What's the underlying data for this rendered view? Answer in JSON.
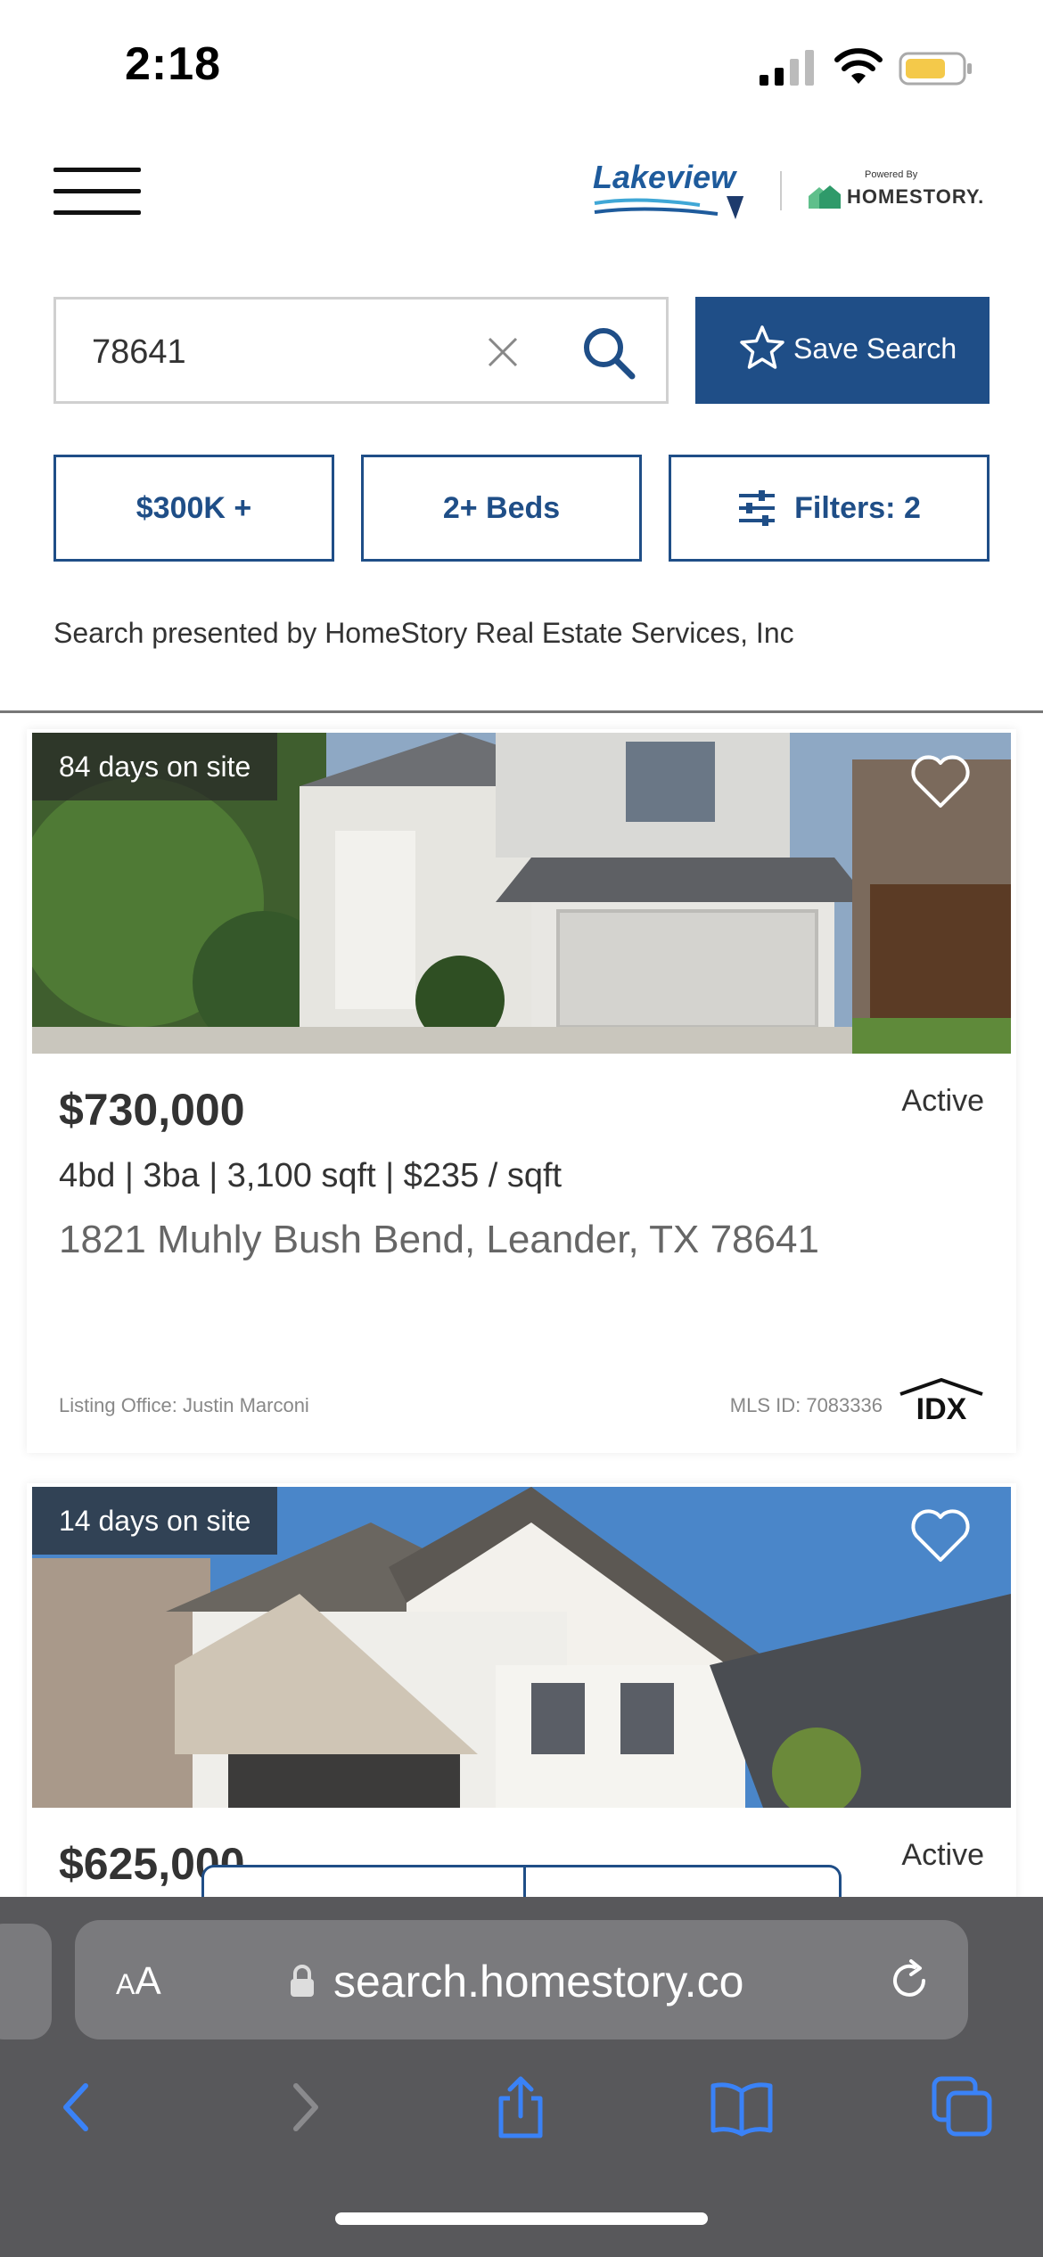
{
  "status_bar": {
    "time": "2:18"
  },
  "header": {
    "brand": "Lakeview",
    "partner_powered": "Powered By",
    "partner_name": "HOMESTORY."
  },
  "search": {
    "value": "78641",
    "save_label": "Save Search"
  },
  "filters": {
    "price": "$300K +",
    "beds": "2+ Beds",
    "more": "Filters: 2"
  },
  "presented_by": "Search presented by HomeStory Real Estate Services, Inc",
  "listings": [
    {
      "days": "84 days on site",
      "price": "$730,000",
      "status": "Active",
      "details": "4bd | 3ba | 3,100 sqft | $235 / sqft",
      "address": "1821 Muhly Bush Bend, Leander, TX 78641",
      "office": "Listing Office: Justin Marconi",
      "mls": "MLS ID: 7083336",
      "idx": "IDX"
    },
    {
      "days": "14 days on site",
      "price": "$625,000",
      "status": "Active"
    }
  ],
  "browser": {
    "aa_small": "A",
    "aa_large": "A",
    "url": "search.homestory.co"
  },
  "colors": {
    "accent": "#1f4e87",
    "browser_bar": "#58585b",
    "browser_blue": "#3a82f7"
  }
}
